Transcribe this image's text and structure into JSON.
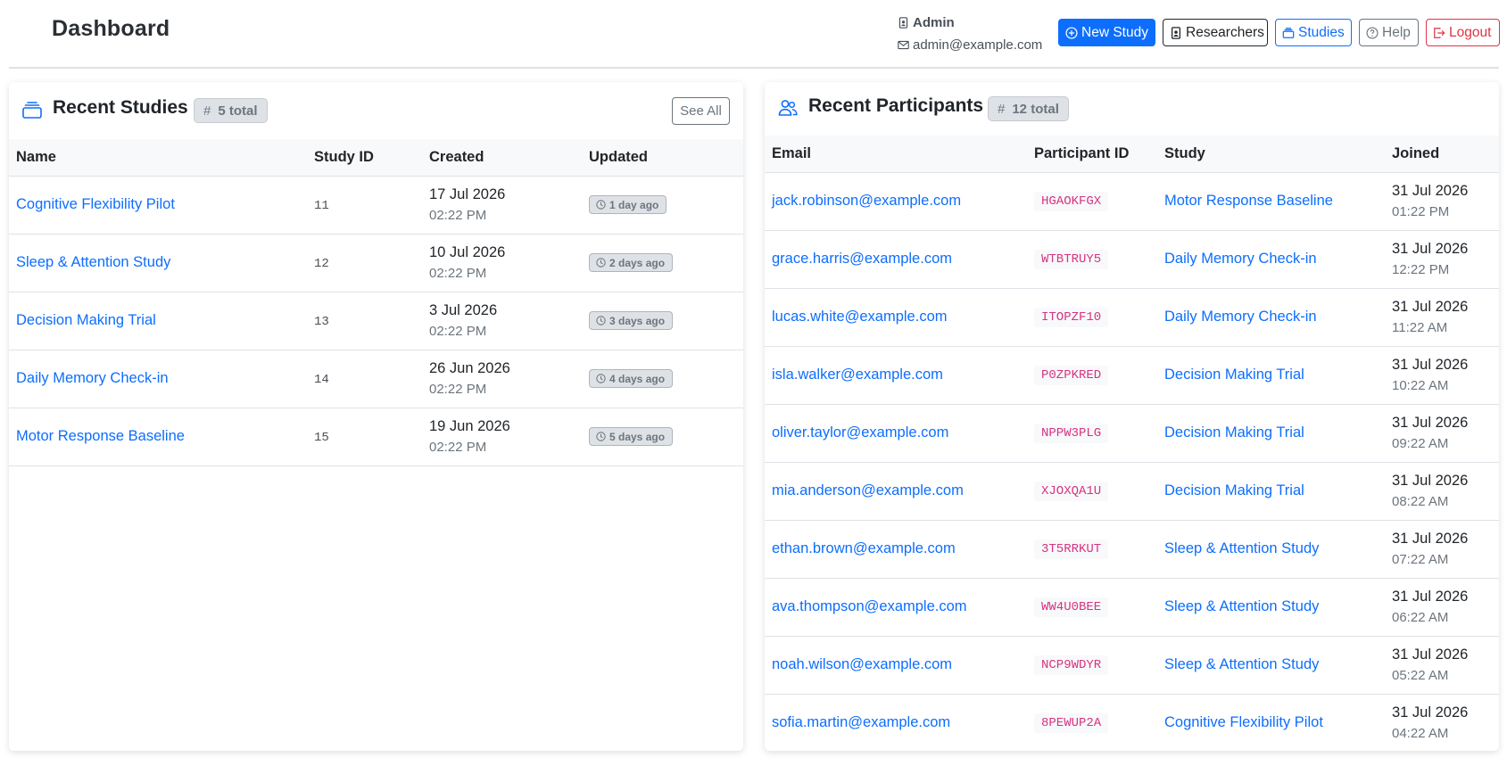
{
  "header": {
    "title": "Dashboard",
    "user_name": "Admin",
    "user_email": "admin@example.com",
    "buttons": {
      "new_study": "New Study",
      "researchers": "Researchers",
      "studies": "Studies",
      "help": "Help",
      "logout": "Logout"
    }
  },
  "colors": {
    "primary": "#0d6efd",
    "danger": "#dc3545",
    "secondary": "#6c757d",
    "code_pink": "#d63384"
  },
  "recent_studies": {
    "title": "Recent Studies",
    "count_label": "5 total",
    "see_all": "See All",
    "columns": [
      "Name",
      "Study ID",
      "Created",
      "Updated"
    ],
    "rows": [
      {
        "name": "Cognitive Flexibility Pilot",
        "id": "11",
        "date": "17 Jul 2026",
        "time": "02:22 PM",
        "updated": "1 day ago"
      },
      {
        "name": "Sleep & Attention Study",
        "id": "12",
        "date": "10 Jul 2026",
        "time": "02:22 PM",
        "updated": "2 days ago"
      },
      {
        "name": "Decision Making Trial",
        "id": "13",
        "date": "3 Jul 2026",
        "time": "02:22 PM",
        "updated": "3 days ago"
      },
      {
        "name": "Daily Memory Check-in",
        "id": "14",
        "date": "26 Jun 2026",
        "time": "02:22 PM",
        "updated": "4 days ago"
      },
      {
        "name": "Motor Response Baseline",
        "id": "15",
        "date": "19 Jun 2026",
        "time": "02:22 PM",
        "updated": "5 days ago"
      }
    ]
  },
  "recent_participants": {
    "title": "Recent Participants",
    "count_label": "12 total",
    "columns": [
      "Email",
      "Participant ID",
      "Study",
      "Joined"
    ],
    "rows": [
      {
        "email": "jack.robinson@example.com",
        "pid": "HGAOKFGX",
        "study": "Motor Response Baseline",
        "date": "31 Jul 2026",
        "time": "01:22 PM"
      },
      {
        "email": "grace.harris@example.com",
        "pid": "WTBTRUY5",
        "study": "Daily Memory Check-in",
        "date": "31 Jul 2026",
        "time": "12:22 PM"
      },
      {
        "email": "lucas.white@example.com",
        "pid": "ITOPZF10",
        "study": "Daily Memory Check-in",
        "date": "31 Jul 2026",
        "time": "11:22 AM"
      },
      {
        "email": "isla.walker@example.com",
        "pid": "P0ZPKRED",
        "study": "Decision Making Trial",
        "date": "31 Jul 2026",
        "time": "10:22 AM"
      },
      {
        "email": "oliver.taylor@example.com",
        "pid": "NPPW3PLG",
        "study": "Decision Making Trial",
        "date": "31 Jul 2026",
        "time": "09:22 AM"
      },
      {
        "email": "mia.anderson@example.com",
        "pid": "XJOXQA1U",
        "study": "Decision Making Trial",
        "date": "31 Jul 2026",
        "time": "08:22 AM"
      },
      {
        "email": "ethan.brown@example.com",
        "pid": "3T5RRKUT",
        "study": "Sleep & Attention Study",
        "date": "31 Jul 2026",
        "time": "07:22 AM"
      },
      {
        "email": "ava.thompson@example.com",
        "pid": "WW4U0BEE",
        "study": "Sleep & Attention Study",
        "date": "31 Jul 2026",
        "time": "06:22 AM"
      },
      {
        "email": "noah.wilson@example.com",
        "pid": "NCP9WDYR",
        "study": "Sleep & Attention Study",
        "date": "31 Jul 2026",
        "time": "05:22 AM"
      },
      {
        "email": "sofia.martin@example.com",
        "pid": "8PEWUP2A",
        "study": "Cognitive Flexibility Pilot",
        "date": "31 Jul 2026",
        "time": "04:22 AM"
      }
    ]
  }
}
